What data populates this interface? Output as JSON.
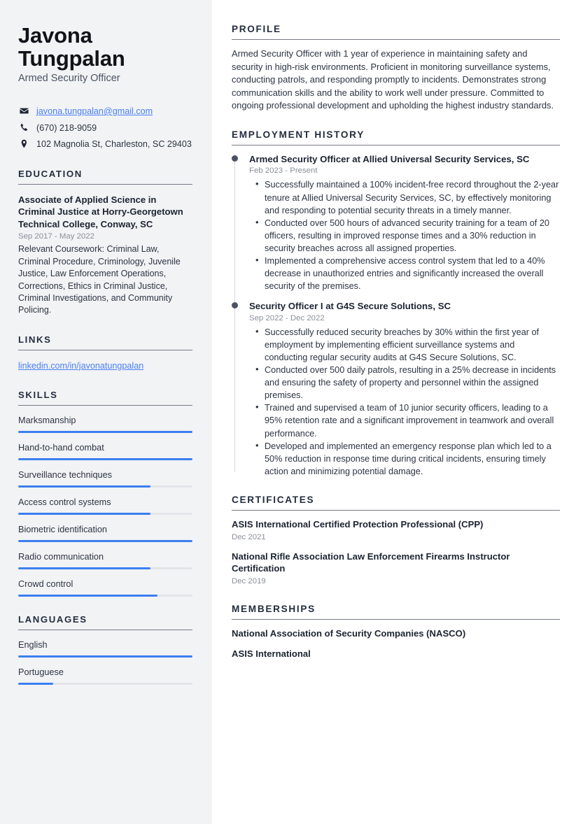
{
  "colors": {
    "accent_blue": "#3b7ff0",
    "link_blue": "#4a7ff5",
    "heading_navy": "#232d3e",
    "sidebar_bg": "#f2f3f5",
    "muted_text": "#8a8f99",
    "timeline_dot": "#4a5263"
  },
  "sidebar": {
    "name": "Javona Tungpalan",
    "name_line1": "Javona",
    "name_line2": "Tungpalan",
    "job_title": "Armed Security Officer",
    "contact": {
      "email": "javona.tungpalan@gmail.com",
      "email_icon": "envelope-icon",
      "phone": "(670) 218-9059",
      "phone_icon": "phone-icon",
      "address": "102 Magnolia St, Charleston, SC 29403",
      "address_icon": "location-pin-icon"
    },
    "education": {
      "heading": "EDUCATION",
      "entries": [
        {
          "title": "Associate of Applied Science in Criminal Justice at Horry-Georgetown Technical College, Conway, SC",
          "date": "Sep 2017 - May 2022",
          "description": "Relevant Coursework: Criminal Law, Criminal Procedure, Criminology, Juvenile Justice, Law Enforcement Operations, Corrections, Ethics in Criminal Justice, Criminal Investigations, and Community Policing."
        }
      ]
    },
    "links": {
      "heading": "LINKS",
      "items": [
        {
          "label": "linkedin.com/in/javonatungpalan"
        }
      ]
    },
    "skills": {
      "heading": "SKILLS",
      "items": [
        {
          "label": "Marksmanship",
          "level": 100
        },
        {
          "label": "Hand-to-hand combat",
          "level": 100
        },
        {
          "label": "Surveillance techniques",
          "level": 76
        },
        {
          "label": "Access control systems",
          "level": 76
        },
        {
          "label": "Biometric identification",
          "level": 100
        },
        {
          "label": "Radio communication",
          "level": 76
        },
        {
          "label": "Crowd control",
          "level": 80
        }
      ]
    },
    "languages": {
      "heading": "LANGUAGES",
      "items": [
        {
          "label": "English",
          "level": 100
        },
        {
          "label": "Portuguese",
          "level": 20
        }
      ]
    }
  },
  "main": {
    "profile": {
      "heading": "PROFILE",
      "text": "Armed Security Officer with 1 year of experience in maintaining safety and security in high-risk environments. Proficient in monitoring surveillance systems, conducting patrols, and responding promptly to incidents. Demonstrates strong communication skills and the ability to work well under pressure. Committed to ongoing professional development and upholding the highest industry standards."
    },
    "employment": {
      "heading": "EMPLOYMENT HISTORY",
      "jobs": [
        {
          "title": "Armed Security Officer at Allied Universal Security Services, SC",
          "date": "Feb 2023 - Present",
          "bullets": [
            "Successfully maintained a 100% incident-free record throughout the 2-year tenure at Allied Universal Security Services, SC, by effectively monitoring and responding to potential security threats in a timely manner.",
            "Conducted over 500 hours of advanced security training for a team of 20 officers, resulting in improved response times and a 30% reduction in security breaches across all assigned properties.",
            "Implemented a comprehensive access control system that led to a 40% decrease in unauthorized entries and significantly increased the overall security of the premises."
          ]
        },
        {
          "title": "Security Officer I at G4S Secure Solutions, SC",
          "date": "Sep 2022 - Dec 2022",
          "bullets": [
            "Successfully reduced security breaches by 30% within the first year of employment by implementing efficient surveillance systems and conducting regular security audits at G4S Secure Solutions, SC.",
            "Conducted over 500 daily patrols, resulting in a 25% decrease in incidents and ensuring the safety of property and personnel within the assigned premises.",
            "Trained and supervised a team of 10 junior security officers, leading to a 95% retention rate and a significant improvement in teamwork and overall performance.",
            "Developed and implemented an emergency response plan which led to a 50% reduction in response time during critical incidents, ensuring timely action and minimizing potential damage."
          ]
        }
      ]
    },
    "certificates": {
      "heading": "CERTIFICATES",
      "items": [
        {
          "title": "ASIS International Certified Protection Professional (CPP)",
          "date": "Dec 2021"
        },
        {
          "title": "National Rifle Association Law Enforcement Firearms Instructor Certification",
          "date": "Dec 2019"
        }
      ]
    },
    "memberships": {
      "heading": "MEMBERSHIPS",
      "items": [
        {
          "label": "National Association of Security Companies (NASCO)"
        },
        {
          "label": "ASIS International"
        }
      ]
    }
  }
}
